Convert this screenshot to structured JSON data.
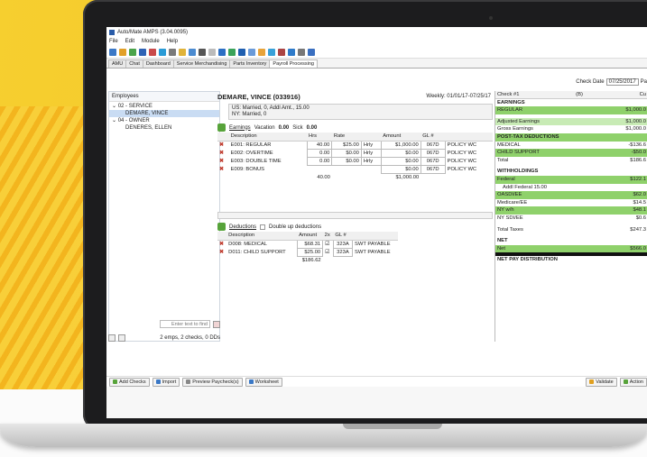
{
  "app": {
    "title": "Auto/Mate AMPS (3.04.0095)"
  },
  "menu": [
    "File",
    "Edit",
    "Module",
    "Help"
  ],
  "tabs": [
    "AMU",
    "Chat",
    "Dashboard",
    "Service Merchandising",
    "Parts Inventory",
    "Payroll Processing"
  ],
  "check_date": {
    "label": "Check Date",
    "value": "07/25/2017",
    "suffix": "Pa"
  },
  "employees": {
    "header": "Employees",
    "tree": [
      "⌄ 02 - SERVICE",
      "DEMARE, VINCE",
      "⌄ 04 - OWNER",
      "DENERES, ELLEN"
    ],
    "find_placeholder": "Enter text to find",
    "summary": "2 emps, 2 checks, 0 DDs"
  },
  "employee": {
    "name": "DEMARE, VINCE (033916)",
    "weekly": "Weekly: 01/01/17-07/25/17",
    "status_line1": "US: Married, 0,  Addl Amt., 15.00",
    "status_line2": "NY: Married, 0"
  },
  "earnings": {
    "label": "Earnings",
    "vacation_label": "Vacation",
    "vacation": "0.00",
    "sick_label": "Sick",
    "sick": "0.00",
    "headers": [
      "Description",
      "Hrs",
      "Rate",
      "",
      "Amount",
      "GL #",
      ""
    ],
    "rows": [
      {
        "desc": "E001: REGULAR",
        "hrs": "40.00",
        "rate": "$25.00",
        "unit": "Hrly",
        "amount": "$1,000.00",
        "gl": "067D",
        "policy": "POLICY WC"
      },
      {
        "desc": "E002: OVERTIME",
        "hrs": "0.00",
        "rate": "$0.00",
        "unit": "Hrly",
        "amount": "$0.00",
        "gl": "067D",
        "policy": "POLICY WC"
      },
      {
        "desc": "E003: DOUBLE TIME",
        "hrs": "0.00",
        "rate": "$0.00",
        "unit": "Hrly",
        "amount": "$0.00",
        "gl": "067D",
        "policy": "POLICY WC"
      },
      {
        "desc": "E009: BONUS",
        "hrs": "",
        "rate": "",
        "unit": "",
        "amount": "$0.00",
        "gl": "067D",
        "policy": "POLICY WC"
      }
    ],
    "total_hrs": "40.00",
    "total_amount": "$1,000.00"
  },
  "deductions": {
    "label": "Deductions",
    "double_up": "Double up deductions",
    "headers": [
      "Description",
      "Amount",
      "2x",
      "GL #",
      ""
    ],
    "rows": [
      {
        "desc": "D008: MEDICAL",
        "amount": "$68.31",
        "gl": "323A",
        "type": "SWT PAYABLE"
      },
      {
        "desc": "D011: CHILD SUPPORT",
        "amount": "$25.00",
        "gl": "323A",
        "type": "SWT PAYABLE"
      }
    ],
    "total": "$186.62"
  },
  "check": {
    "head": "Check #1",
    "head2": "(B)",
    "head3": "Cu",
    "rows": [
      {
        "l": "EARNINGS",
        "r": "",
        "s": "b"
      },
      {
        "l": "REGULAR",
        "r": "$1,000.0",
        "s": "g"
      },
      {
        "l": "",
        "r": "",
        "s": "sp"
      },
      {
        "l": "Adjusted Earnings",
        "r": "$1,000.0",
        "s": "lg"
      },
      {
        "l": "Gross Earnings",
        "r": "$1,000.0",
        "s": ""
      },
      {
        "l": "POST-TAX DEDUCTIONS",
        "r": "",
        "s": "b g"
      },
      {
        "l": "MEDICAL",
        "r": "-$136.6",
        "s": ""
      },
      {
        "l": "CHILD SUPPORT",
        "r": "-$50.0",
        "s": "g"
      },
      {
        "l": "Total",
        "r": "$186.6",
        "s": ""
      },
      {
        "l": "",
        "r": "",
        "s": "sp"
      },
      {
        "l": "WITHHOLDINGS",
        "r": "",
        "s": "b"
      },
      {
        "l": "Federal",
        "r": "$122.1",
        "s": "g"
      },
      {
        "l": "Addl Federal 15.00",
        "r": "",
        "s": "ind"
      },
      {
        "l": "OASDI/EE",
        "r": "$62.0",
        "s": "g"
      },
      {
        "l": "Medicare/EE",
        "r": "$14.5",
        "s": ""
      },
      {
        "l": "NY w/h",
        "r": "$48.1",
        "s": "g"
      },
      {
        "l": "NY SDI/EE",
        "r": "$0.6",
        "s": ""
      },
      {
        "l": "",
        "r": "",
        "s": "sp"
      },
      {
        "l": "Total Taxes",
        "r": "$247.3",
        "s": ""
      },
      {
        "l": "",
        "r": "",
        "s": "sp"
      },
      {
        "l": "NET",
        "r": "",
        "s": "b"
      },
      {
        "l": "Net",
        "r": "$566.0",
        "s": "g"
      },
      {
        "l": "",
        "r": "",
        "s": "blk"
      },
      {
        "l": "NET PAY DISTRIBUTION",
        "r": "",
        "s": "b"
      }
    ]
  },
  "bottom": {
    "add_checks": "Add Checks",
    "import": "Import",
    "preview": "Preview Paycheck(s)",
    "worksheet": "Worksheet",
    "validate": "Validate",
    "actions": "Action"
  },
  "colors": {
    "green": "#8fd16b",
    "light_green": "#c8ebb5",
    "selected": "#c9dcf3"
  }
}
